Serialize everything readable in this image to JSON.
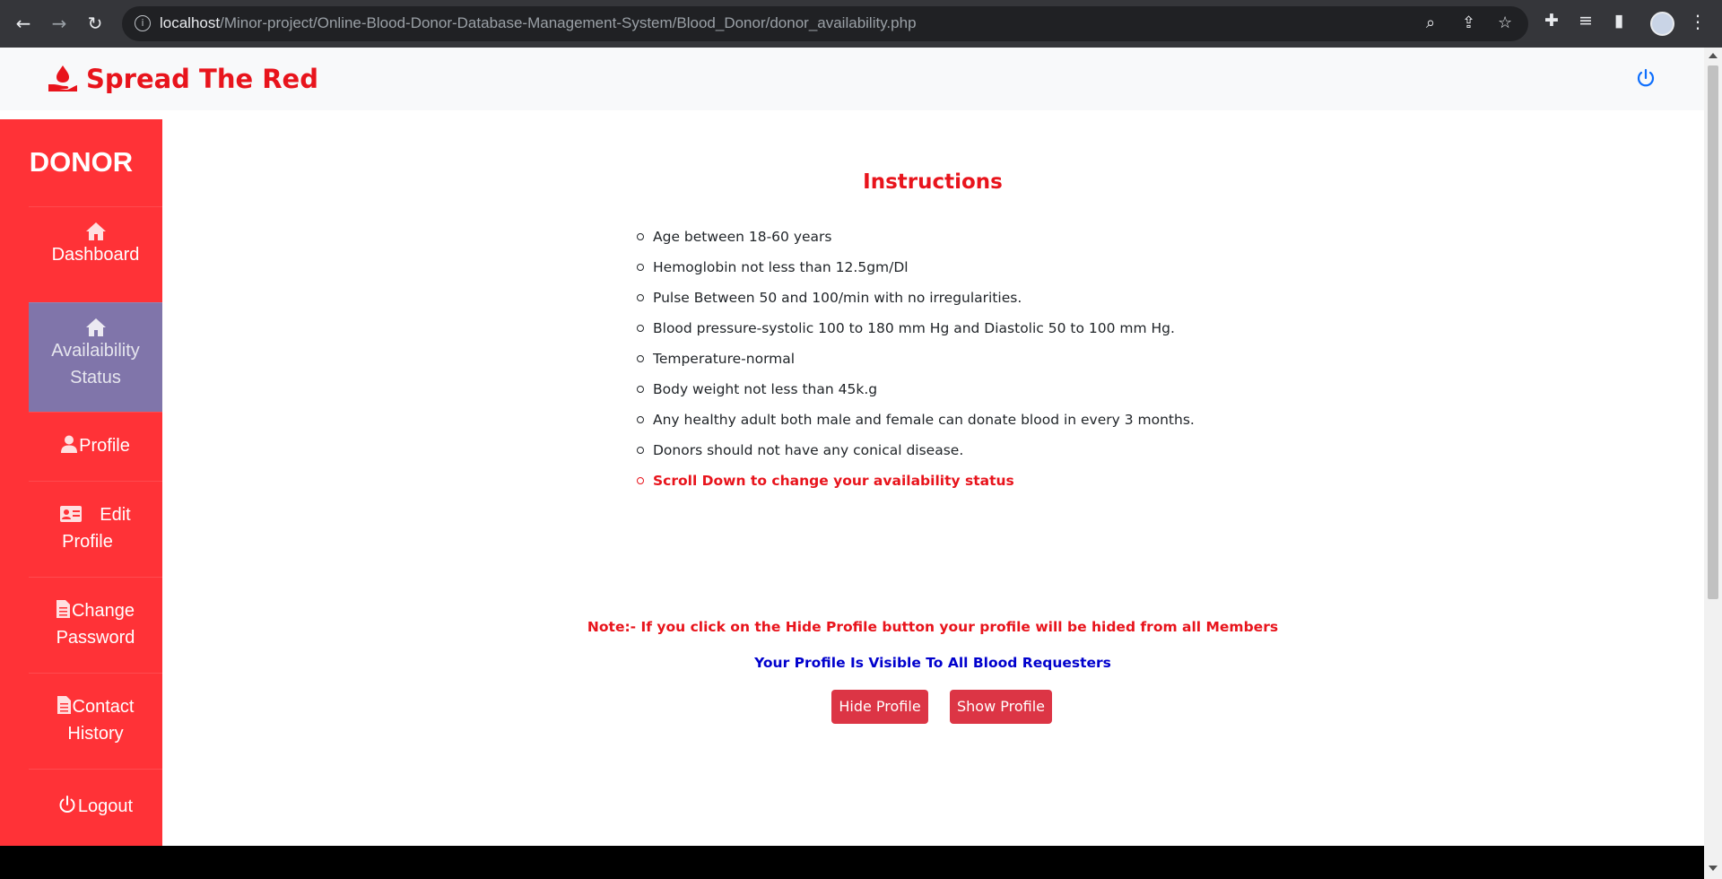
{
  "browser": {
    "url_host": "localhost",
    "url_path": "/Minor-project/Online-Blood-Donor-Database-Management-System/Blood_Donor/donor_availability.php"
  },
  "brand": {
    "name": "Spread The Red",
    "color": "#e8141c"
  },
  "sidebar": {
    "title": "DONOR",
    "items": [
      {
        "label": "Dashboard",
        "icon": "home-icon"
      },
      {
        "label": "Availaibility Status",
        "icon": "home-icon"
      },
      {
        "label": "Profile",
        "icon": "user-icon"
      },
      {
        "label": "Edit Profile",
        "icon": "id-card-icon"
      },
      {
        "label": "Change Password",
        "icon": "document-icon"
      },
      {
        "label": "Contact History",
        "icon": "document-icon"
      },
      {
        "label": "Logout",
        "icon": "power-icon"
      }
    ],
    "bg_color": "#ff3237",
    "active_color": "#8075aa"
  },
  "main": {
    "title": "Instructions",
    "instructions": [
      "Age between 18-60 years",
      "Hemoglobin not less than 12.5gm/Dl",
      "Pulse Between 50 and 100/min with no irregularities.",
      "Blood pressure-systolic 100 to 180 mm Hg and Diastolic 50 to 100 mm Hg.",
      "Temperature-normal",
      "Body weight not less than 45k.g",
      "Any healthy adult both male and female can donate blood in every 3 months.",
      "Donors should not have any conical disease.",
      "Scroll Down to change your availability status"
    ],
    "note": "Note:- If you click on the Hide Profile button your profile will be hided from all Members",
    "status_text": "Your Profile Is Visible To All Blood Requesters",
    "hide_button": "Hide Profile",
    "show_button": "Show Profile"
  }
}
